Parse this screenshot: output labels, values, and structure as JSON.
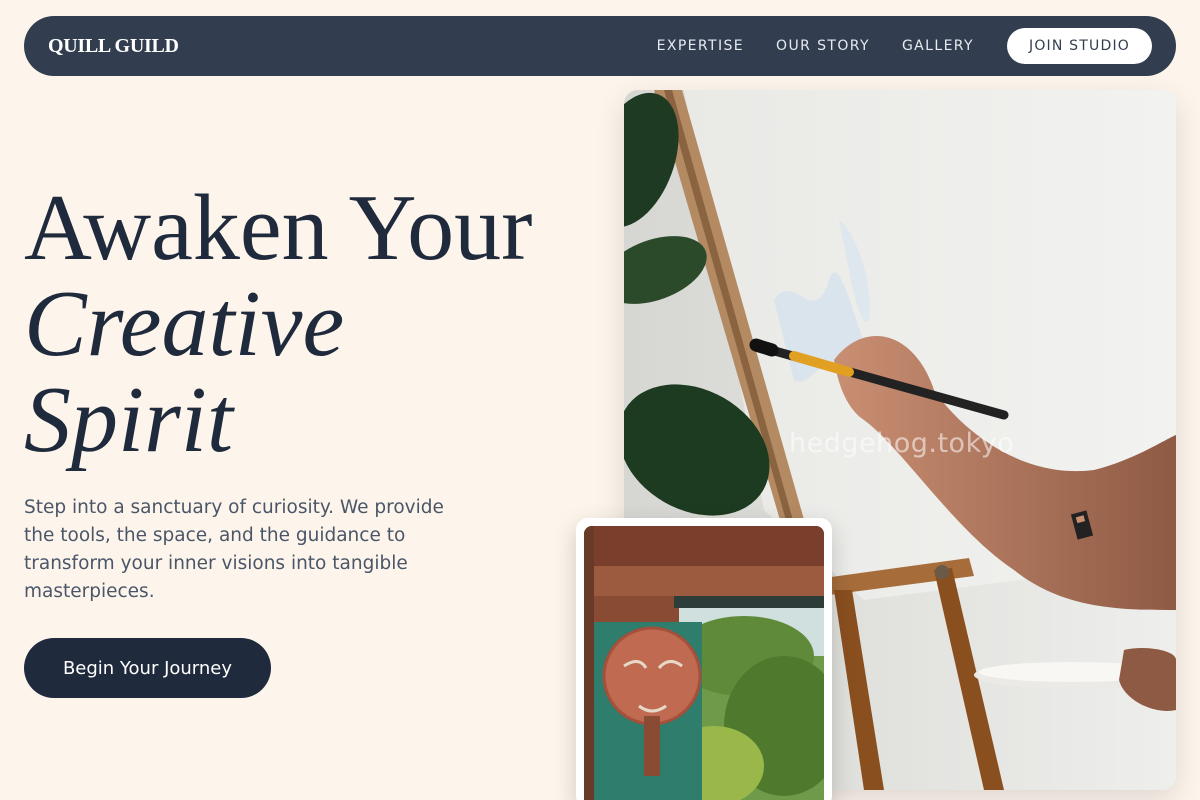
{
  "nav": {
    "brand": "QUILL GUILD",
    "links": [
      "EXPERTISE",
      "OUR STORY",
      "GALLERY"
    ],
    "cta": "JOIN STUDIO"
  },
  "hero": {
    "title_line1": "Awaken Your",
    "title_line2": "Creative",
    "title_line3": "Spirit",
    "description": "Step into a sanctuary of curiosity. We provide the tools, the space, and the guidance to transform your inner visions into tangible masterpieces.",
    "cta": "Begin Your Journey"
  },
  "images": {
    "main_watermark": "hedgehog.tokyo",
    "main_alt": "painter-at-easel",
    "secondary_alt": "moon-face-mural"
  },
  "colors": {
    "background": "#fdf5ec",
    "nav": "#323e4f",
    "primary": "#1f2a3c",
    "text_muted": "#4a5668",
    "accent": "#c97a2b"
  }
}
